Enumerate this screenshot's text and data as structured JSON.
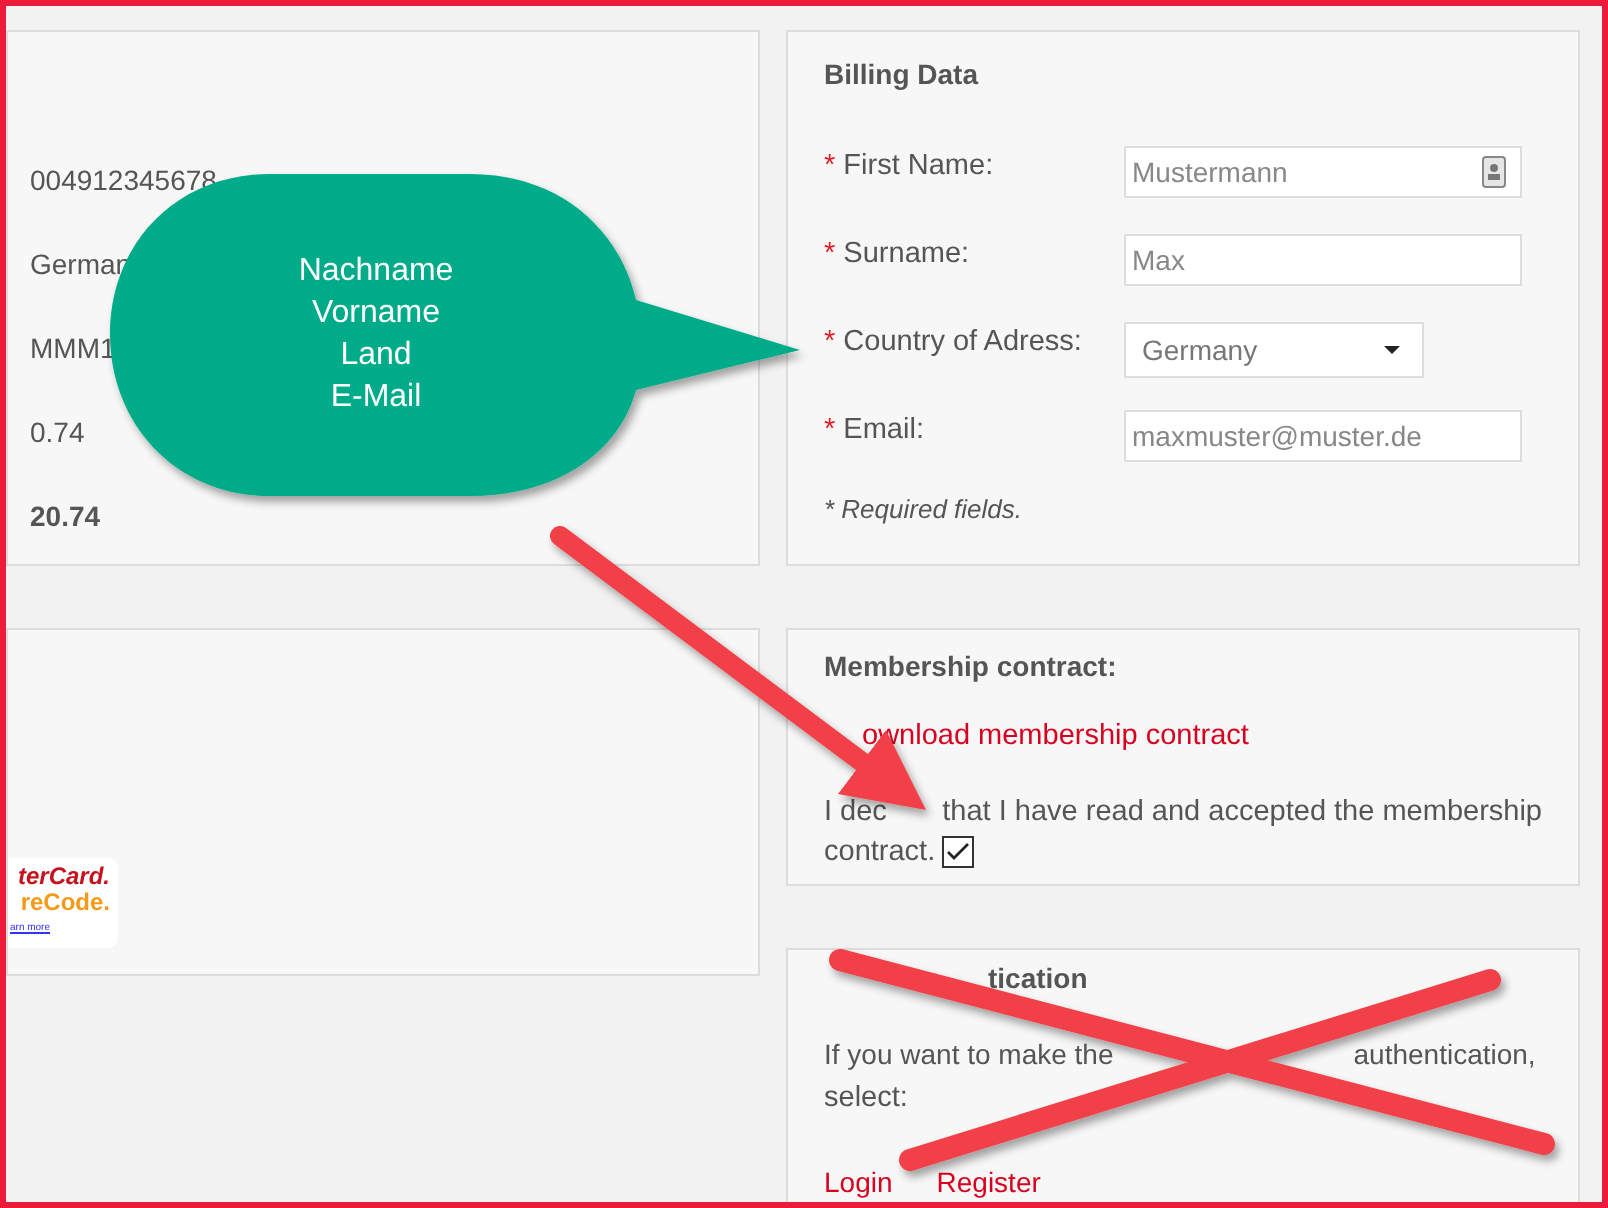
{
  "order_summary": {
    "values": [
      {
        "text": "004912345678",
        "bold": false
      },
      {
        "text": "German",
        "bold": false
      },
      {
        "text": "MMM1",
        "bold": false
      },
      {
        "text": "0.74",
        "bold": false
      },
      {
        "text": "20.74",
        "bold": true
      }
    ]
  },
  "payment_logo": {
    "line_1": "terCard.",
    "line_2": "reCode.",
    "link": "arn more"
  },
  "billing": {
    "title": "Billing Data",
    "fields": [
      {
        "marker": "*",
        "label": "First Name:",
        "kind": "text",
        "value": "Mustermann",
        "has_icon": true
      },
      {
        "marker": "*",
        "label": "Surname:",
        "kind": "text",
        "value": "Max",
        "has_icon": false
      },
      {
        "marker": "*",
        "label": "Country of Adress:",
        "kind": "select",
        "value": "Germany"
      },
      {
        "marker": "*",
        "label": "Email:",
        "kind": "text",
        "value": "maxmuster@muster.de",
        "has_icon": false
      }
    ],
    "note": "* Required fields."
  },
  "membership": {
    "title": "Membership contract:",
    "download_link": "ownload membership contract",
    "declaration_start": "I dec",
    "declaration_rest": "that I have read and accepted the membership",
    "declaration_end": "contract.",
    "checked": true
  },
  "authentication": {
    "title_end": "tication",
    "text_start": "If you want to make the",
    "text_end": "authentication,",
    "text_line_2": "select:",
    "links": [
      "Login",
      "Register"
    ]
  },
  "annotation": {
    "callout_lines": [
      "Nachname",
      "Vorname",
      "Land",
      "E-Mail"
    ]
  }
}
